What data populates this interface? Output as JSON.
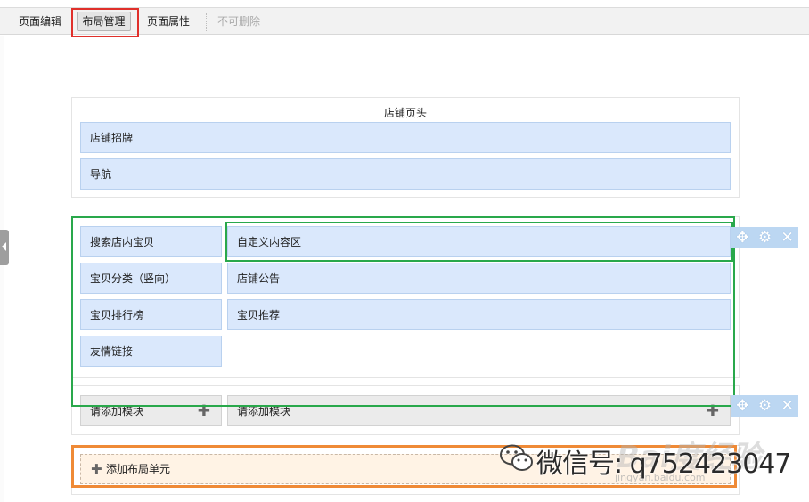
{
  "toolbar": {
    "page_edit": "页面编辑",
    "layout_manage": "布局管理",
    "page_props": "页面属性",
    "no_delete": "不可删除"
  },
  "header_section": {
    "title": "店铺页头",
    "modules": [
      "店铺招牌",
      "导航"
    ]
  },
  "main_section": {
    "left_modules": [
      "搜索店内宝贝",
      "宝贝分类（竖向）",
      "宝贝排行榜",
      "友情链接"
    ],
    "right_modules": [
      "自定义内容区",
      "店铺公告",
      "宝贝推荐"
    ]
  },
  "add_row": {
    "left_label": "请添加模块",
    "right_label": "请添加模块"
  },
  "add_unit": {
    "label": "添加布局单元"
  },
  "controls": {
    "move_icon": "move-icon",
    "settings_icon": "gear-icon",
    "close_icon": "close-icon"
  },
  "watermark": {
    "text": "微信号: q752423047",
    "baidu": "Bai度经验",
    "sub": "jingyan.baidu.com"
  },
  "colors": {
    "highlight_red": "#e0302b",
    "highlight_green": "#29a84b",
    "highlight_orange": "#ef8a36",
    "module_blue": "#dae8fc"
  }
}
